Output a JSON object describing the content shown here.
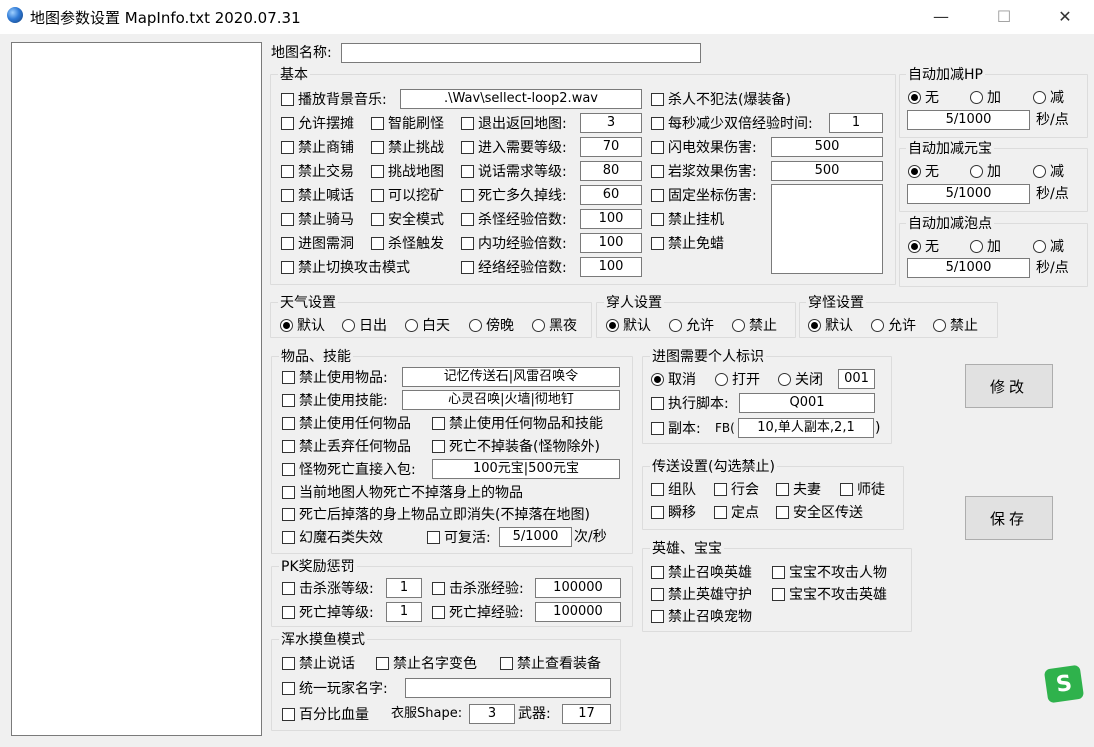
{
  "window": {
    "title": "地图参数设置 MapInfo.txt  2020.07.31",
    "minimize": "—",
    "maximize": "☐",
    "close": "✕"
  },
  "map_name": {
    "label": "地图名称:",
    "value": ""
  },
  "basic": {
    "title": "基本",
    "bgm": {
      "label": "播放背景音乐:",
      "value": ".\\Wav\\sellect-loop2.wav"
    },
    "no_pk_crime": "杀人不犯法(爆装备)",
    "allow_stall": "允许摆摊",
    "smart_refresh": "智能刷怪",
    "exit_return_map": {
      "label": "退出返回地图:",
      "value": "3"
    },
    "double_exp_time": {
      "label": "每秒减少双倍经验时间:",
      "value": "1"
    },
    "no_shop": "禁止商铺",
    "no_challenge": "禁止挑战",
    "enter_level": {
      "label": "进入需要等级:",
      "value": "70"
    },
    "lightning_dmg": {
      "label": "闪电效果伤害:",
      "value": "500"
    },
    "no_trade": "禁止交易",
    "challenge_map": "挑战地图",
    "talk_level": {
      "label": "说话需求等级:",
      "value": "80"
    },
    "lava_dmg": {
      "label": "岩浆效果伤害:",
      "value": "500"
    },
    "no_shout": "禁止喊话",
    "can_mine": "可以挖矿",
    "death_disconnect": {
      "label": "死亡多久掉线:",
      "value": "60"
    },
    "fixed_coord_dmg": {
      "label": "固定坐标伤害:",
      "value": ""
    },
    "no_ride": "禁止骑马",
    "safe_mode": "安全模式",
    "kill_exp_mult": {
      "label": "杀怪经验倍数:",
      "value": "100"
    },
    "no_hangup": "禁止挂机",
    "cave_req": "进图需洞",
    "kill_trigger": "杀怪触发",
    "internal_exp_mult": {
      "label": "内功经验倍数:",
      "value": "100"
    },
    "no_immunity": "禁止免蜡",
    "no_switch_attack": "禁止切换攻击模式",
    "meridian_exp_mult": {
      "label": "经络经验倍数:",
      "value": "100"
    }
  },
  "auto_hp": {
    "title": "自动加减HP",
    "options": [
      "无",
      "加",
      "减"
    ],
    "value": "5/1000",
    "unit": "秒/点"
  },
  "auto_yuanbao": {
    "title": "自动加减元宝",
    "options": [
      "无",
      "加",
      "减"
    ],
    "value": "5/1000",
    "unit": "秒/点"
  },
  "auto_bubble": {
    "title": "自动加减泡点",
    "options": [
      "无",
      "加",
      "减"
    ],
    "value": "5/1000",
    "unit": "秒/点"
  },
  "weather": {
    "title": "天气设置",
    "options": [
      "默认",
      "日出",
      "白天",
      "傍晚",
      "黑夜"
    ]
  },
  "pass_person": {
    "title": "穿人设置",
    "options": [
      "默认",
      "允许",
      "禁止"
    ]
  },
  "pass_monster": {
    "title": "穿怪设置",
    "options": [
      "默认",
      "允许",
      "禁止"
    ]
  },
  "items": {
    "title": "物品、技能",
    "no_use_item": {
      "label": "禁止使用物品:",
      "value": "记忆传送石|风雷召唤令"
    },
    "no_use_skill": {
      "label": "禁止使用技能:",
      "value": "心灵召唤|火墙|彻地钉"
    },
    "no_any_item": "禁止使用任何物品",
    "no_any_item_skill": "禁止使用任何物品和技能",
    "no_drop_item": "禁止丢弃任何物品",
    "death_no_drop": "死亡不掉装备(怪物除外)",
    "monster_drop_bag": {
      "label": "怪物死亡直接入包:",
      "value": "100元宝|500元宝"
    },
    "player_death_no_drop": "当前地图人物死亡不掉落身上的物品",
    "drop_vanish": "死亡后掉落的身上物品立即消失(不掉落在地图)",
    "phantom_invalid": "幻魔石类失效",
    "revive": {
      "label": "可复活:",
      "value": "5/1000",
      "unit": "次/秒"
    }
  },
  "pk": {
    "title": "PK奖励惩罚",
    "kill_level": {
      "label": "击杀涨等级:",
      "value": "1"
    },
    "kill_exp": {
      "label": "击杀涨经验:",
      "value": "100000"
    },
    "death_level": {
      "label": "死亡掉等级:",
      "value": "1"
    },
    "death_exp": {
      "label": "死亡掉经验:",
      "value": "100000"
    }
  },
  "fish": {
    "title": "浑水摸鱼模式",
    "no_talk": "禁止说话",
    "no_name_color": "禁止名字变色",
    "no_view_equip": "禁止查看装备",
    "unify_name": {
      "label": "统一玩家名字:",
      "value": ""
    },
    "percent_hp": "百分比血量",
    "shape_label": "衣服Shape:",
    "shape_value": "3",
    "weapon_label": "武器:",
    "weapon_value": "17"
  },
  "personal_flag": {
    "title": "进图需要个人标识",
    "options": [
      "取消",
      "打开",
      "关闭"
    ],
    "code": "001",
    "script": {
      "label": "执行脚本:",
      "value": "Q001"
    },
    "fb": {
      "label": "副本:",
      "prefix": "FB(",
      "value": "10,单人副本,2,1",
      "suffix": ")"
    }
  },
  "teleport": {
    "title": "传送设置(勾选禁止)",
    "team": "组队",
    "guild": "行会",
    "spouse": "夫妻",
    "mentor": "师徒",
    "blink": "瞬移",
    "fixed_point": "定点",
    "safe_zone": "安全区传送"
  },
  "hero": {
    "title": "英雄、宝宝",
    "no_summon_hero": "禁止召唤英雄",
    "pet_no_attack_people": "宝宝不攻击人物",
    "no_hero_guard": "禁止英雄守护",
    "pet_no_attack_hero": "宝宝不攻击英雄",
    "no_summon_pet": "禁止召唤宠物"
  },
  "buttons": {
    "modify": "修改",
    "save": "保存"
  },
  "corner_logo": "S"
}
